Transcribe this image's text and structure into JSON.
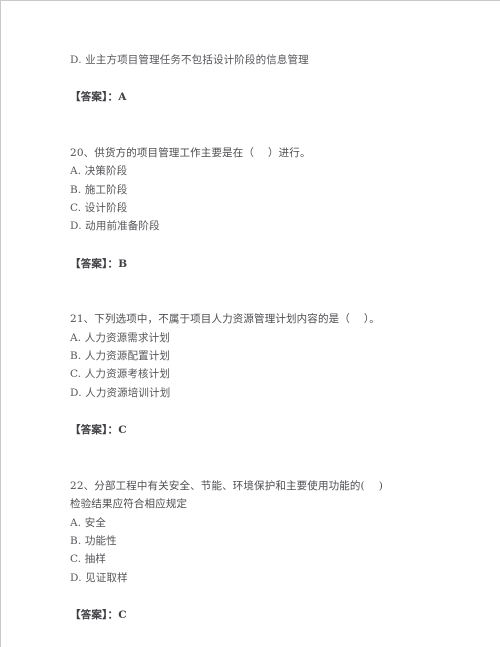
{
  "page": {
    "background_color": "#ffffff",
    "text_color": "#56565a",
    "answer_label": "【答案】",
    "answer_separator": "："
  },
  "blocks": [
    {
      "type": "trailing_option",
      "lines": [
        "D. 业主方项目管理任务不包括设计阶段的信息管理"
      ],
      "answer": "【答案】：A"
    },
    {
      "type": "question",
      "number": "20",
      "stem": [
        "20、供货方的项目管理工作主要是在（    ）进行。"
      ],
      "options": [
        "A. 决策阶段",
        "B. 施工阶段",
        "C. 设计阶段",
        "D. 动用前准备阶段"
      ],
      "answer": "【答案】：B"
    },
    {
      "type": "question",
      "number": "21",
      "stem": [
        "21、下列选项中，不属于项目人力资源管理计划内容的是（    ）。"
      ],
      "options": [
        "A. 人力资源需求计划",
        "B. 人力资源配置计划",
        "C. 人力资源考核计划",
        "D. 人力资源培训计划"
      ],
      "answer": "【答案】：C"
    },
    {
      "type": "question",
      "number": "22",
      "stem": [
        "22、分部工程中有关安全、节能、环境保护和主要使用功能的(    )",
        "检验结果应符合相应规定"
      ],
      "options": [
        "A. 安全",
        "B. 功能性",
        "C. 抽样",
        "D. 见证取样"
      ],
      "answer": "【答案】：C"
    }
  ]
}
